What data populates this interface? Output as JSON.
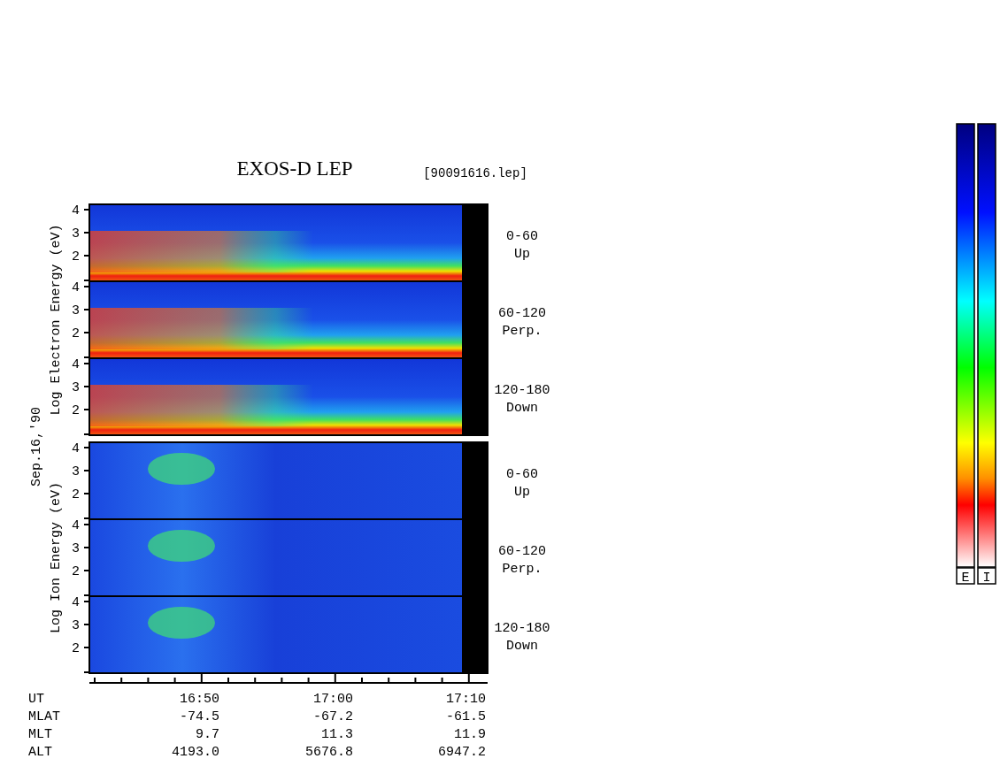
{
  "title": "EXOS-D LEP",
  "file": "[90091616.lep]",
  "date": "Sep.16,'90",
  "groups": [
    {
      "kind": "electron",
      "ylabel": "Log Electron Energy (eV)",
      "panels": [
        {
          "range": "0-60",
          "direction": "Up",
          "yticks": [
            "4",
            "3",
            "2"
          ]
        },
        {
          "range": "60-120",
          "direction": "Perp.",
          "yticks": [
            "4",
            "3",
            "2"
          ]
        },
        {
          "range": "120-180",
          "direction": "Down",
          "yticks": [
            "4",
            "3",
            "2"
          ]
        }
      ]
    },
    {
      "kind": "ion",
      "ylabel": "Log Ion Energy (eV)",
      "panels": [
        {
          "range": "0-60",
          "direction": "Up",
          "yticks": [
            "4",
            "3",
            "2"
          ]
        },
        {
          "range": "60-120",
          "direction": "Perp.",
          "yticks": [
            "4",
            "3",
            "2"
          ]
        },
        {
          "range": "120-180",
          "direction": "Down",
          "yticks": [
            "4",
            "3",
            "2"
          ]
        }
      ]
    }
  ],
  "time_axis": {
    "rows": [
      {
        "label": "UT",
        "values": [
          "16:50",
          "17:00",
          "17:10"
        ]
      },
      {
        "label": "MLAT",
        "values": [
          "-74.5",
          "-67.2",
          "-61.5"
        ]
      },
      {
        "label": "MLT",
        "values": [
          "9.7",
          "11.3",
          "11.9"
        ]
      },
      {
        "label": "ALT",
        "values": [
          "4193.0",
          "5676.8",
          "6947.2"
        ]
      }
    ]
  },
  "colorbars": [
    {
      "label": "E"
    },
    {
      "label": "I"
    }
  ]
}
